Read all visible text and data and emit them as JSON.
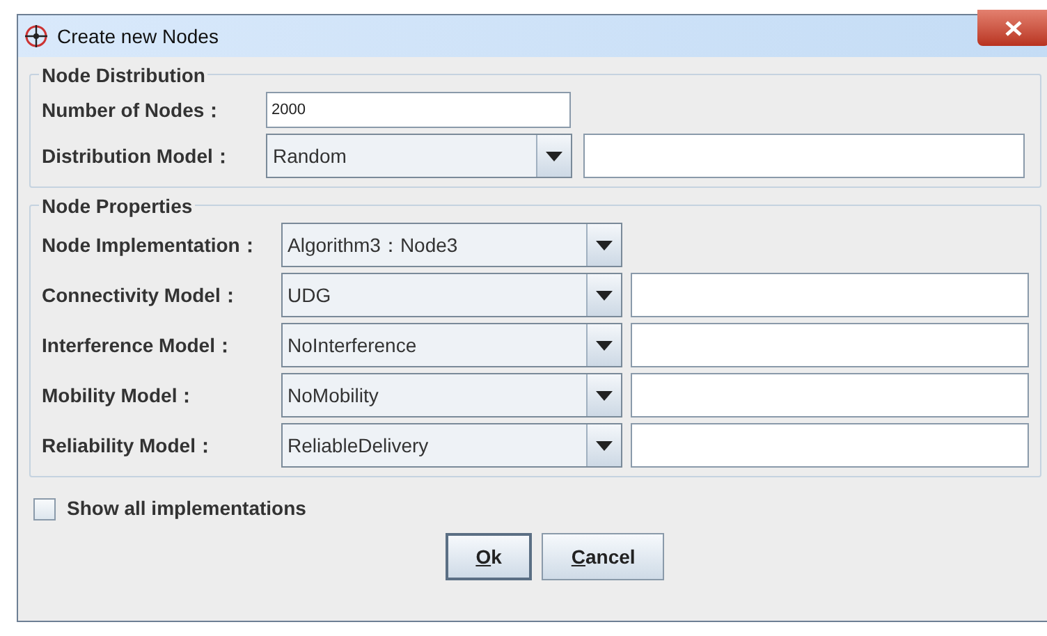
{
  "window": {
    "title": "Create new Nodes"
  },
  "node_distribution": {
    "title": "Node Distribution",
    "number_of_nodes": {
      "label": "Number of Nodes：",
      "value": "2000"
    },
    "distribution_model": {
      "label": "Distribution Model：",
      "value": "Random",
      "parameter_field": true
    }
  },
  "node_properties": {
    "title": "Node Properties",
    "rows": [
      {
        "label": "Node Implementation：",
        "value": "Algorithm3：Node3",
        "parameter_field": false
      },
      {
        "label": "Connectivity Model：",
        "value": "UDG",
        "parameter_field": true
      },
      {
        "label": "Interference Model：",
        "value": "NoInterference",
        "parameter_field": true
      },
      {
        "label": "Mobility Model：",
        "value": "NoMobility",
        "parameter_field": true
      },
      {
        "label": "Reliability Model：",
        "value": "ReliableDelivery",
        "parameter_field": true
      }
    ]
  },
  "show_all": {
    "label": "Show all implementations",
    "checked": false
  },
  "buttons": [
    {
      "label": "Ok",
      "mnemonic_first": true,
      "default": true
    },
    {
      "label": "Cancel",
      "mnemonic_first": true,
      "default": false
    }
  ]
}
